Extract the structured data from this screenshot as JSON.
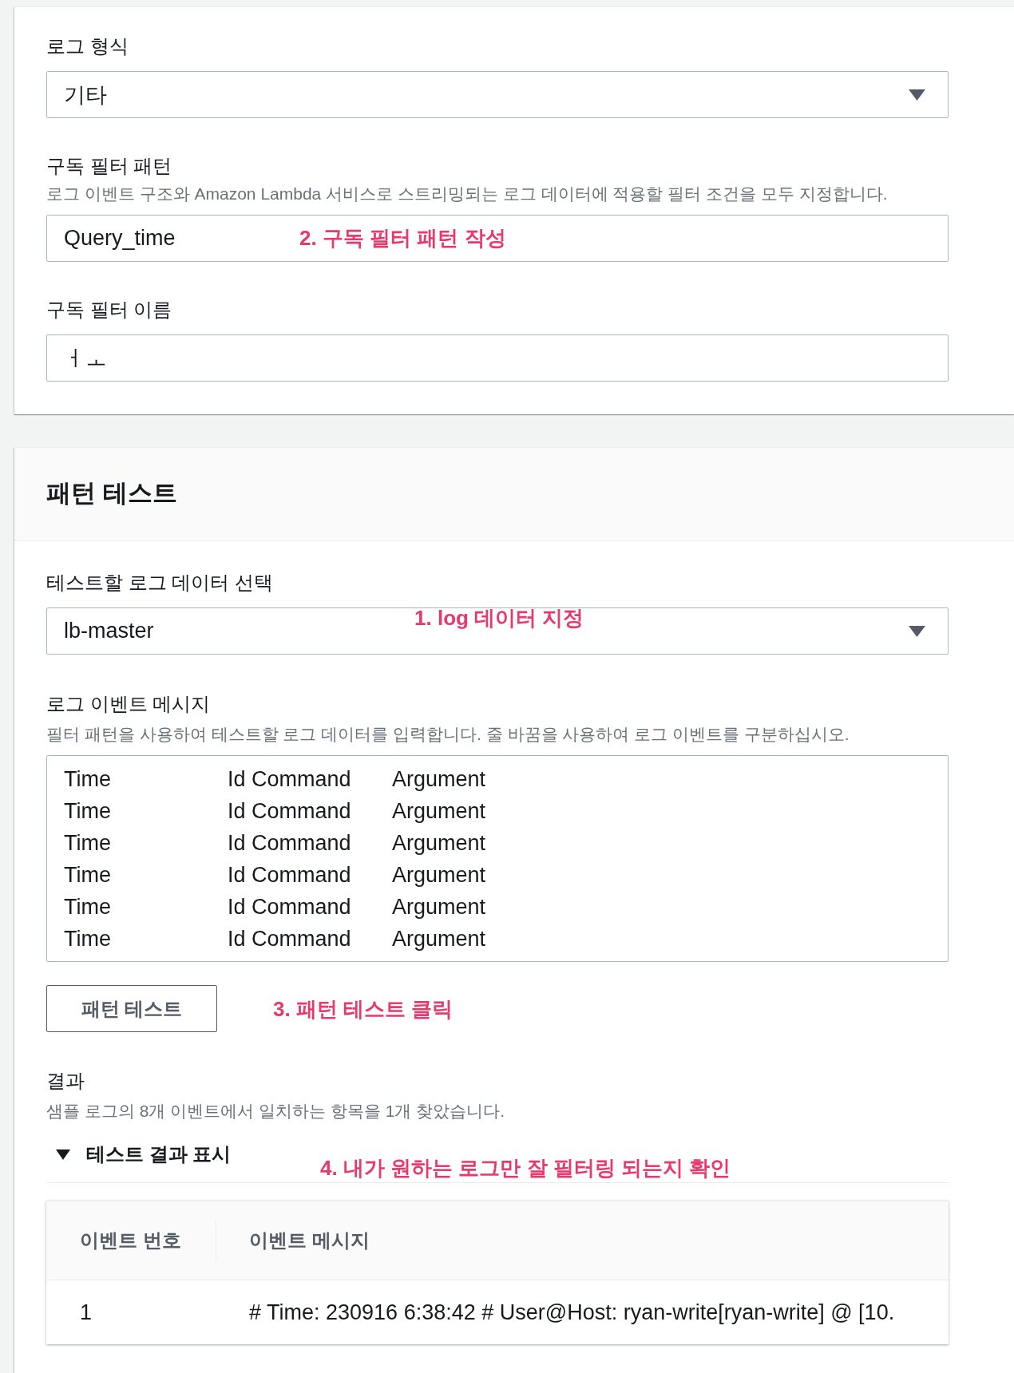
{
  "subscription": {
    "fields": [
      {
        "kind": "select",
        "label": "로그 형식",
        "value": "기타"
      },
      {
        "kind": "input",
        "label": "구독 필터 패턴",
        "description": "로그 이벤트 구조와 Amazon Lambda 서비스로 스트리밍되는 로그 데이터에 적용할 필터 조건을 모두 지정합니다.",
        "value": "Query_time",
        "annotation": "2. 구독 필터 패턴 작성"
      },
      {
        "kind": "input",
        "label": "구독 필터 이름",
        "value": "ㅓㅗ"
      }
    ]
  },
  "pattern_test": {
    "title": "패턴 테스트",
    "fields": [
      {
        "kind": "select",
        "label": "테스트할 로그 데이터 선택",
        "value": "lb-master",
        "annotation": "1. log 데이터 지정"
      },
      {
        "kind": "textarea",
        "label": "로그 이벤트 메시지",
        "description": "필터 패턴을 사용하여 테스트할 로그 데이터를 입력합니다. 줄 바꿈을 사용하여 로그 이벤트를 구분하십시오.",
        "lines": [
          [
            "Time",
            "Id Command",
            "Argument"
          ],
          [
            "Time",
            "Id Command",
            "Argument"
          ],
          [
            "Time",
            "Id Command",
            "Argument"
          ],
          [
            "Time",
            "Id Command",
            "Argument"
          ],
          [
            "Time",
            "Id Command",
            "Argument"
          ],
          [
            "Time",
            "Id Command",
            "Argument"
          ]
        ]
      }
    ],
    "test_button": {
      "label": "패턴 테스트",
      "annotation": "3. 패턴 테스트 클릭"
    },
    "result": {
      "label": "결과",
      "description": "샘플 로그의 8개 이벤트에서 일치하는 항목을 1개 찾았습니다.",
      "toggle": {
        "label": "테스트 결과 표시",
        "expanded": true
      },
      "annotation": "4. 내가 원하는 로그만 잘 필터링 되는지 확인",
      "table": {
        "columns": [
          "이벤트 번호",
          "이벤트 메시지"
        ],
        "rows": [
          [
            "1",
            "# Time: 230916 6:38:42 # User@Host: ryan-write[ryan-write] @ [10."
          ]
        ]
      }
    }
  }
}
